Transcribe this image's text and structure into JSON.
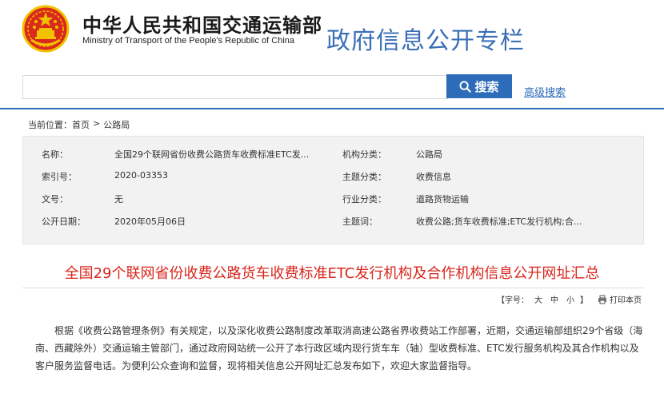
{
  "header": {
    "ministry_cn": "中华人民共和国交通运输部",
    "ministry_en": "Ministry of Transport of the People's Republic of China",
    "column_title": "政府信息公开专栏"
  },
  "search": {
    "input_value": "",
    "button_label": "搜索",
    "advanced_label": "高级搜索"
  },
  "breadcrumb": {
    "prefix": "当前位置：",
    "items": [
      "首页",
      "公路局"
    ],
    "separator": ">"
  },
  "info": {
    "name_label": "名称：",
    "name_value": "全国29个联网省份收费公路货车收费标准ETC发...",
    "index_label": "索引号：",
    "index_value": "2020-03353",
    "doc_label": "文号：",
    "doc_value": "无",
    "date_label": "公开日期：",
    "date_value": "2020年05月06日",
    "org_label": "机构分类：",
    "org_value": "公路局",
    "topic_label": "主题分类：",
    "topic_value": "收费信息",
    "industry_label": "行业分类：",
    "industry_value": "道路货物运输",
    "keywords_label": "主题词：",
    "keywords_value": "收费公路;货车收费标准;ETC发行机构;合..."
  },
  "article": {
    "title": "全国29个联网省份收费公路货车收费标准ETC发行机构及合作机构信息公开网址汇总",
    "font_size_label": "【字号：",
    "font_large": "大",
    "font_medium": "中",
    "font_small": "小",
    "font_size_end": "】",
    "print_label": "打印本页",
    "body": "根据《收费公路管理条例》有关规定，以及深化收费公路制度改革取消高速公路省界收费站工作部署，近期，交通运输部组织29个省级（海南、西藏除外）交通运输主管部门，通过政府网站统一公开了本行政区域内现行货车车（轴）型收费标准、ETC发行服务机构及其合作机构以及客户服务监督电话。为便利公众查询和监督，现将相关信息公开网址汇总发布如下，欢迎大家监督指导。"
  },
  "colors": {
    "accent_blue": "#2d6cb8",
    "title_red": "#d9261c",
    "column_blue": "#3a6fb6",
    "emblem_red": "#d92a1c",
    "emblem_gold": "#f2c200"
  },
  "icons": {
    "emblem": "national-emblem-icon",
    "search": "search-icon",
    "print": "printer-icon"
  }
}
